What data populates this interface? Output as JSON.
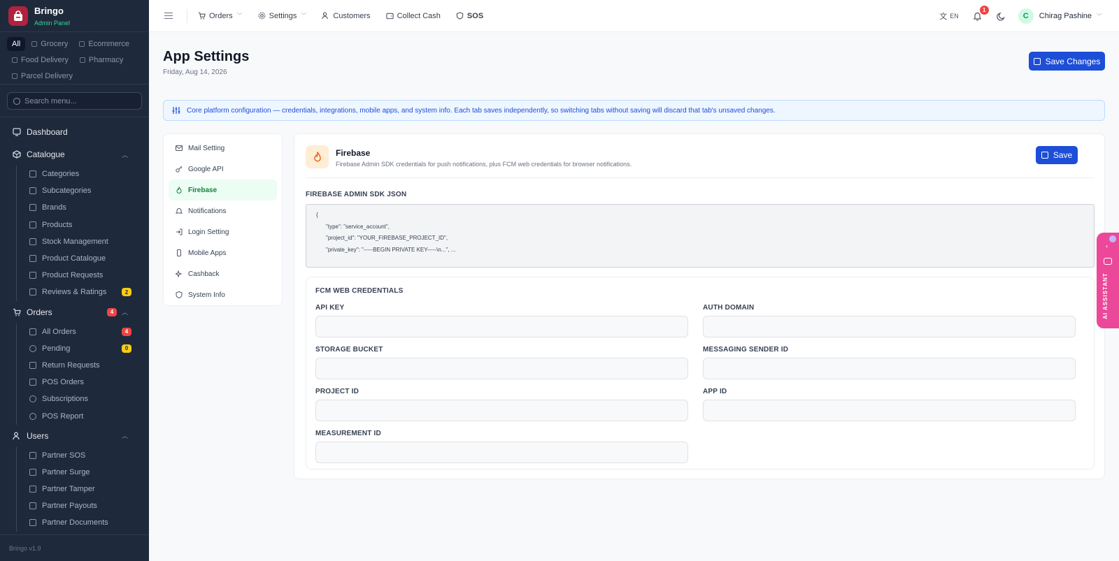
{
  "brand": {
    "name": "Bringo",
    "sub": "Admin Panel",
    "version": "Bringo v1.9"
  },
  "modules": [
    "All",
    "Grocery",
    "Ecommerce",
    "Food Delivery",
    "Pharmacy",
    "Parcel Delivery"
  ],
  "search": {
    "placeholder": "Search menu..."
  },
  "nav": {
    "dashboard": "Dashboard",
    "catalogue": {
      "label": "Catalogue",
      "items": [
        {
          "label": "Categories",
          "icon": "grid-icon"
        },
        {
          "label": "Subcategories",
          "icon": "list-check-icon"
        },
        {
          "label": "Brands",
          "icon": "pen-icon"
        },
        {
          "label": "Products",
          "icon": "box-icon"
        },
        {
          "label": "Stock Management",
          "icon": "warehouse-icon"
        },
        {
          "label": "Product Catalogue",
          "icon": "book-icon"
        },
        {
          "label": "Product Requests",
          "icon": "image-icon"
        },
        {
          "label": "Reviews & Ratings",
          "icon": "star-icon",
          "badge": "2"
        }
      ]
    },
    "orders": {
      "label": "Orders",
      "badge": "4",
      "items": [
        {
          "label": "All Orders",
          "icon": "cart-icon",
          "badge": "4",
          "badge_color": "red"
        },
        {
          "label": "Pending",
          "icon": "clock-icon",
          "badge": "0",
          "badge_color": "yellow"
        },
        {
          "label": "Return Requests",
          "icon": "return-icon"
        },
        {
          "label": "POS Orders",
          "icon": "pos-icon"
        },
        {
          "label": "Subscriptions",
          "icon": "refresh-icon"
        },
        {
          "label": "POS Report",
          "icon": "pie-icon"
        }
      ]
    },
    "users": {
      "label": "Users",
      "items": [
        {
          "label": "Partner SOS",
          "icon": "sos-icon"
        },
        {
          "label": "Partner Surge",
          "icon": "bolt-icon"
        },
        {
          "label": "Partner Tamper",
          "icon": "alert-icon"
        },
        {
          "label": "Partner Payouts",
          "icon": "payout-icon"
        },
        {
          "label": "Partner Documents",
          "icon": "document-icon"
        }
      ]
    }
  },
  "topbar": {
    "orders": "Orders",
    "settings": "Settings",
    "customers": "Customers",
    "collect_cash": "Collect Cash",
    "sos": "SOS",
    "lang": "EN",
    "notif_count": "1",
    "user_initial": "C",
    "user_name": "Chirag Pashine"
  },
  "page": {
    "title": "App Settings",
    "date": "Friday, Aug 14, 2026",
    "save_changes": "Save Changes",
    "info": "Core platform configuration — credentials, integrations, mobile apps, and system info. Each tab saves independently, so switching tabs without saving will discard that tab's unsaved changes."
  },
  "tabs": [
    "Mail Setting",
    "Google API",
    "Firebase",
    "Notifications",
    "Login Setting",
    "Mobile Apps",
    "Cashback",
    "System Info"
  ],
  "panel": {
    "title": "Firebase",
    "desc": "Firebase Admin SDK credentials for push notifications, plus FCM web credentials for browser notifications.",
    "save": "Save",
    "json_label": "FIREBASE ADMIN SDK JSON",
    "json_lines": [
      "{",
      "\"type\": \"service_account\",",
      "\"project_id\": \"YOUR_FIREBASE_PROJECT_ID\",",
      "\"private_key\": \"-----BEGIN PRIVATE KEY-----\\n...\", ..."
    ],
    "fcm_title": "FCM WEB CREDENTIALS",
    "fields": {
      "api_key": "API KEY",
      "auth_domain": "AUTH DOMAIN",
      "storage_bucket": "STORAGE BUCKET",
      "messaging_sender_id": "MESSAGING SENDER ID",
      "project_id": "PROJECT ID",
      "app_id": "APP ID",
      "measurement_id": "MEASUREMENT ID"
    }
  },
  "ai_assistant": "AI ASSISTANT",
  "colors": {
    "sidebar": "#1e2a3b",
    "primary": "#1d4ed8",
    "active_tab": "#15803d",
    "brand": "#b1223e",
    "ai": "#ec4899"
  }
}
